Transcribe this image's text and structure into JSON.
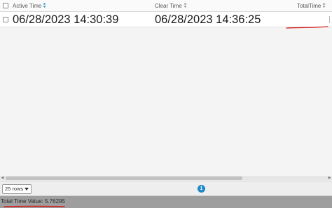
{
  "grid": {
    "columns": [
      {
        "key": "active_time",
        "label": "Active Time"
      },
      {
        "key": "clear_time",
        "label": "Clear Time"
      },
      {
        "key": "total_time",
        "label": "TotalTime"
      }
    ],
    "rows": [
      {
        "active_time": "06/28/2023 14:30:39",
        "clear_time": "06/28/2023 14:36:25",
        "total_time": ""
      }
    ]
  },
  "pager": {
    "rows_per_page": "25 rows",
    "current_page": "1"
  },
  "footer": {
    "total_label": "Total Time Value: 5.76295"
  },
  "colors": {
    "page_button": "#1e88c9",
    "annotation_stroke": "#d42020",
    "footer_bg": "#9e9e9e"
  }
}
